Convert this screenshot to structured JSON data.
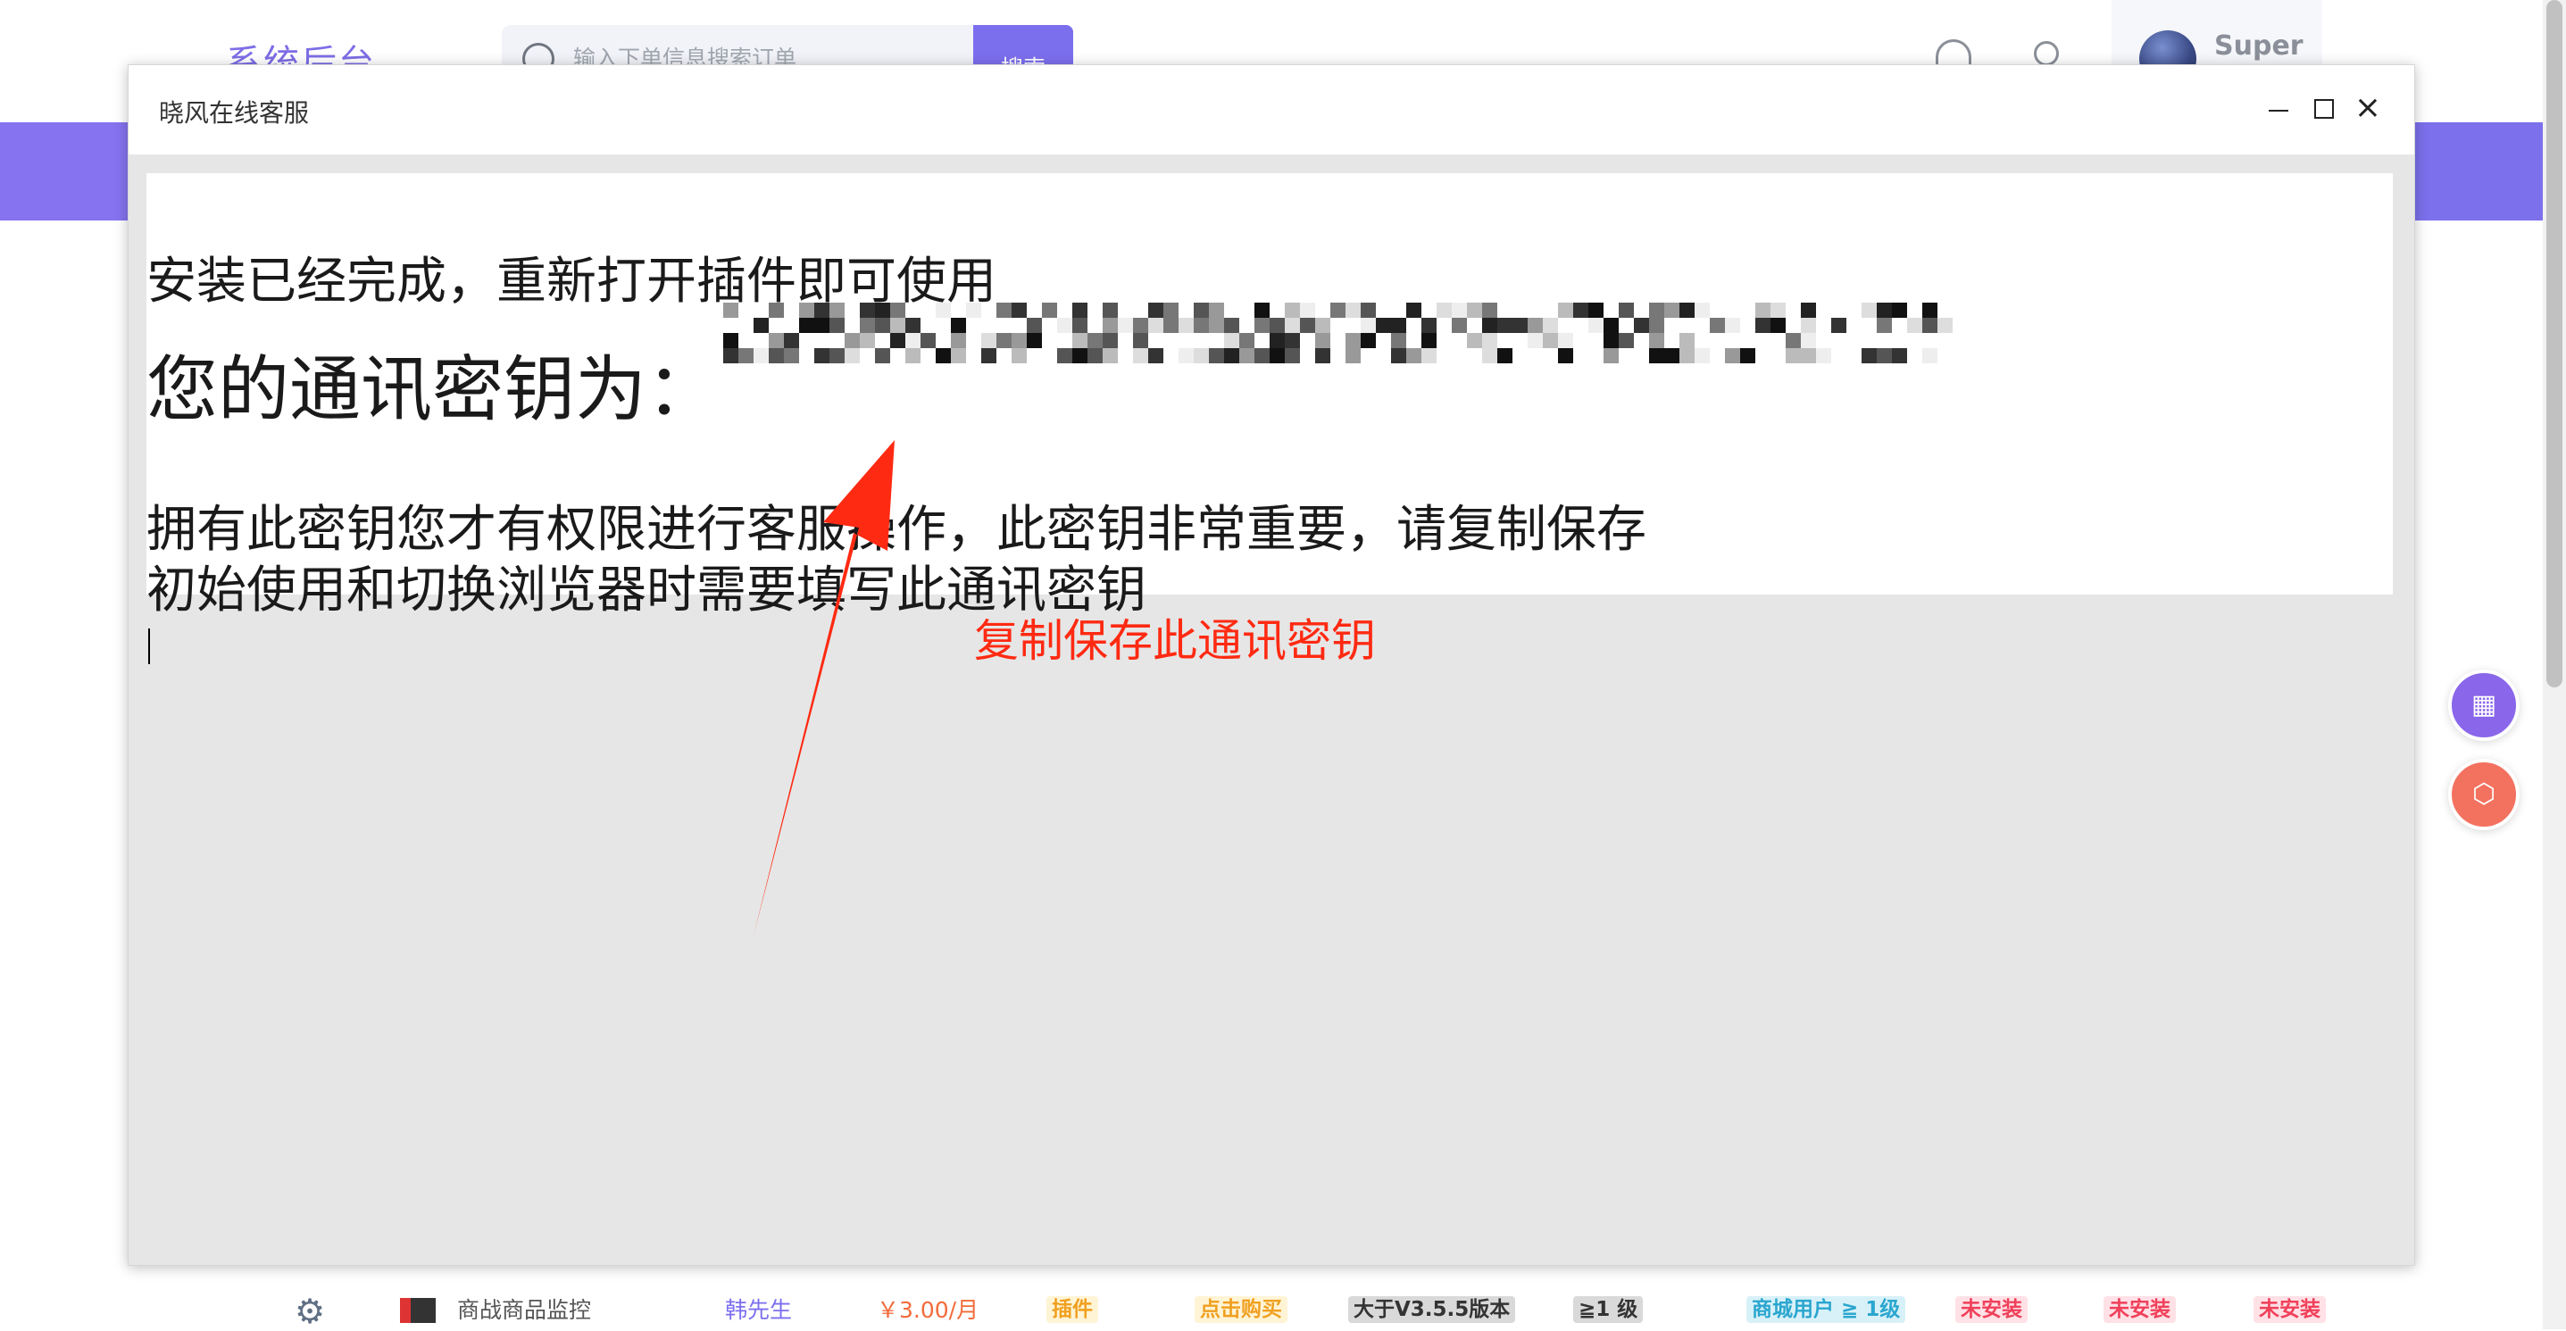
{
  "page": {
    "brand": "系统后台",
    "search": {
      "placeholder": "输入下单信息搜索订单",
      "button_label": "搜索"
    },
    "user": {
      "name": "Super"
    }
  },
  "dialog": {
    "title": "晓风在线客服",
    "content": {
      "line1": "安装已经完成，重新打开插件即可使用",
      "key_label": "您的通讯密钥为：",
      "line3": "拥有此密钥您才有权限进行客服操作，此密钥非常重要，请复制保存",
      "line4": "初始使用和切换浏览器时需要填写此通讯密钥"
    },
    "annotation": "复制保存此通讯密钥"
  },
  "table_row": {
    "name": "商战商品监控",
    "author": "韩先生",
    "price": "￥3.00/月",
    "type": "插件",
    "buy": "点击购买",
    "version": "大于V3.5.5版本",
    "level": "≧1 级",
    "user_level": "商城用户 ≧ 1级",
    "status_1": "未安装",
    "status_2": "未安装",
    "status_3": "未安装"
  },
  "colors": {
    "accent": "#7c6fee",
    "annotation": "#ff2a12"
  }
}
